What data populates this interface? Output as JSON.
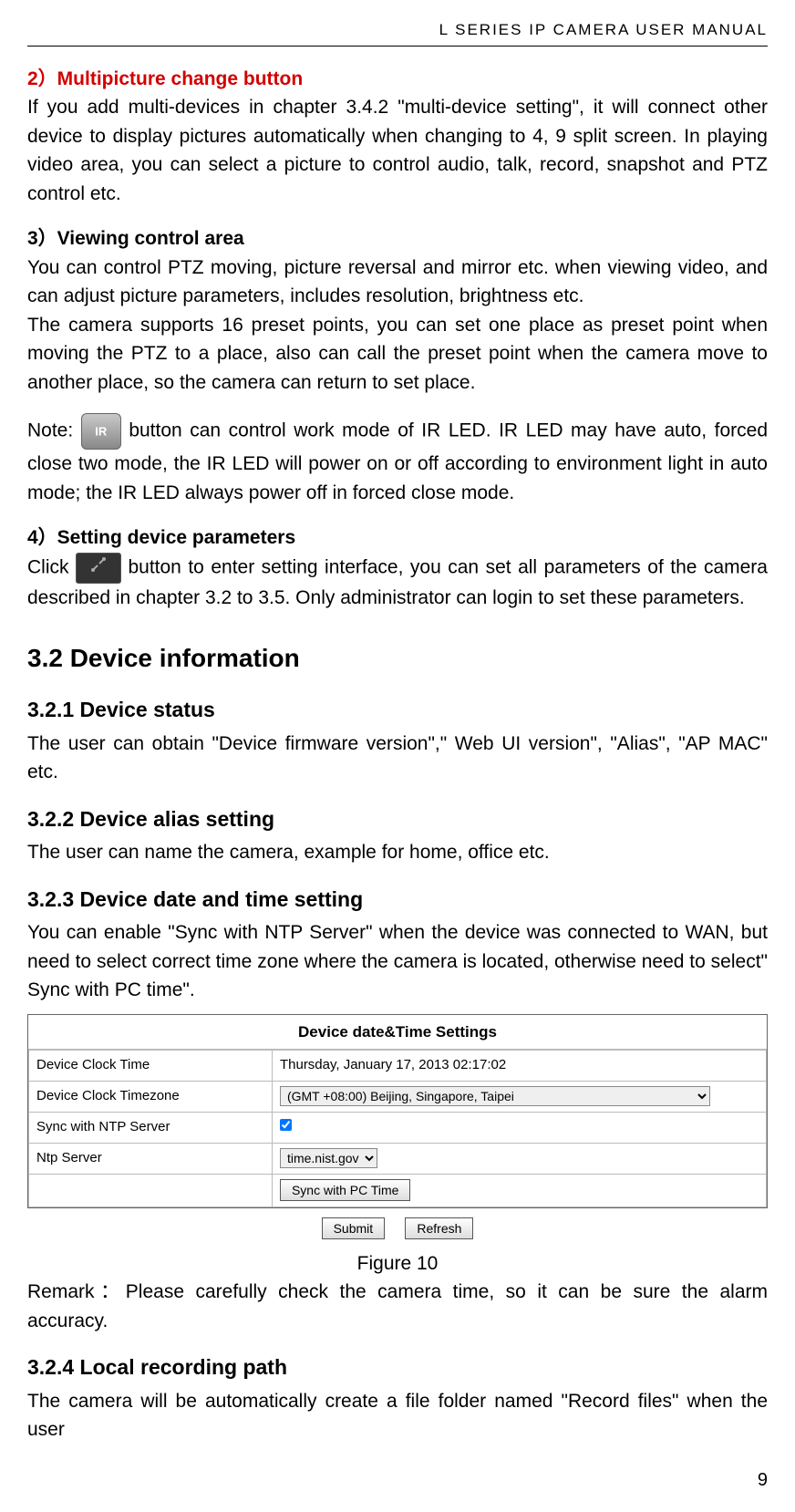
{
  "header": {
    "title": "L SERIES IP CAMERA USER MANUAL"
  },
  "sec2": {
    "label": "2）Multipicture change button",
    "body": "If you add multi-devices in chapter 3.4.2 \"multi-device setting\", it will connect other device to display pictures automatically when changing to 4, 9 split screen. In playing video area, you can select a picture to control audio, talk, record, snapshot and PTZ control etc."
  },
  "sec3": {
    "label": "3）Viewing control area",
    "body1": "You can control PTZ moving, picture reversal and mirror etc. when viewing video, and can adjust picture parameters, includes resolution, brightness etc.",
    "body2": "The camera supports 16 preset points, you can set one place as preset point when moving the PTZ to a place, also can call the preset point when the camera move to another place, so the camera can return to set place.",
    "note_prefix": "Note: ",
    "ir_label": "IR",
    "note_suffix": " button can control work mode of IR LED. IR LED may have auto, forced close two mode, the IR LED will power on or off according to environment light in auto mode; the IR LED always power off in forced close mode."
  },
  "sec4": {
    "label": "4）Setting device parameters",
    "click_prefix": "Click ",
    "click_suffix": " button to enter setting interface, you can set all parameters of the camera described in chapter 3.2 to 3.5. Only administrator can login to set these parameters."
  },
  "h32": {
    "title": "3.2  Device information"
  },
  "s321": {
    "title": "3.2.1  Device status",
    "body": "The user can obtain \"Device firmware version\",\" Web UI version\", \"Alias\", \"AP MAC\" etc."
  },
  "s322": {
    "title": "3.2.2  Device alias setting",
    "body": "The user can name the camera, example for home, office etc."
  },
  "s323": {
    "title": "3.2.3  Device date and time setting",
    "body": "You can enable \"Sync with NTP Server\" when the device was connected to WAN, but need to select correct time zone where the camera is located, otherwise need to select\" Sync with PC time\"."
  },
  "figure": {
    "title": "Device date&Time Settings",
    "rows": {
      "r1": {
        "label": "Device Clock Time",
        "value": "Thursday, January 17, 2013 02:17:02"
      },
      "r2": {
        "label": "Device Clock Timezone",
        "value": "(GMT +08:00) Beijing, Singapore, Taipei"
      },
      "r3": {
        "label": "Sync with NTP Server"
      },
      "r4": {
        "label": "Ntp Server",
        "value": "time.nist.gov"
      },
      "r5": {
        "btn": "Sync with PC Time"
      }
    },
    "submit": "Submit",
    "refresh": "Refresh",
    "caption": "Figure 10"
  },
  "remark": "Remark：Please carefully check the camera time, so it can be sure the alarm accuracy.",
  "s324": {
    "title": "3.2.4  Local recording path",
    "body": "The camera will be automatically create a file folder named \"Record files\" when the user"
  },
  "page": "9"
}
